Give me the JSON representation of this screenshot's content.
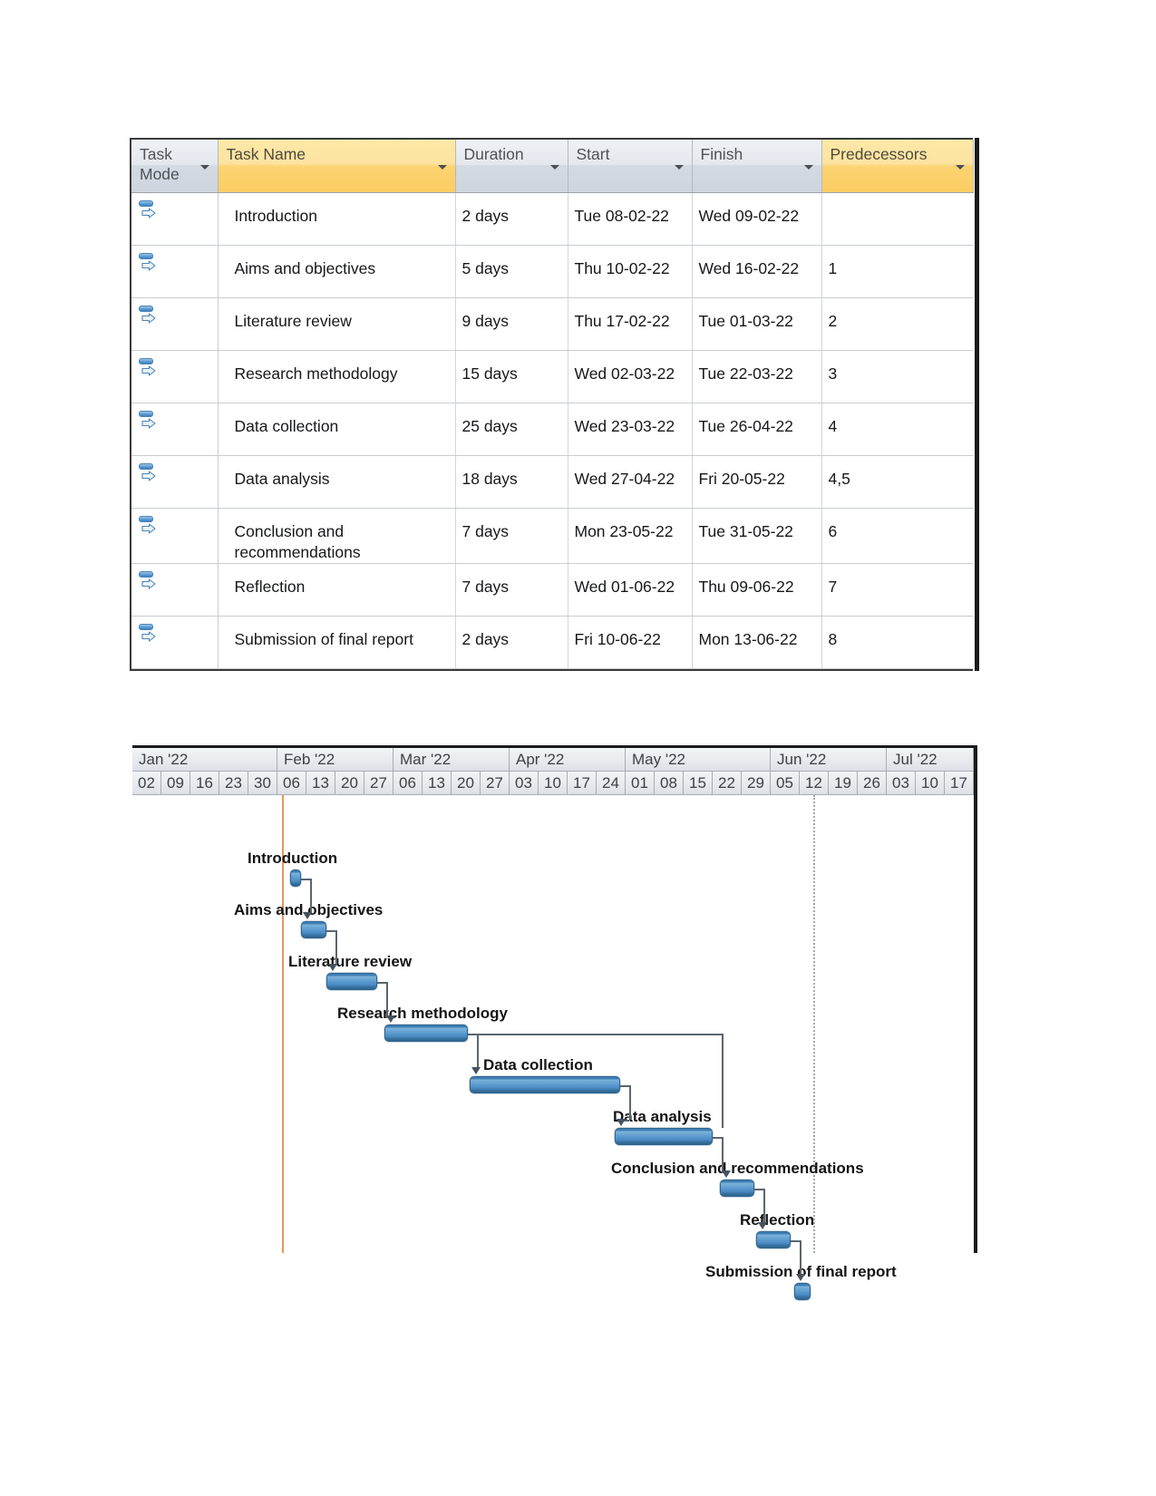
{
  "table": {
    "columns": [
      {
        "key": "mode",
        "label": "Task\nMode",
        "accent": false,
        "has_filter": true
      },
      {
        "key": "name",
        "label": "Task Name",
        "accent": true,
        "has_filter": true
      },
      {
        "key": "dur",
        "label": "Duration",
        "accent": false,
        "has_filter": true
      },
      {
        "key": "start",
        "label": "Start",
        "accent": false,
        "has_filter": true
      },
      {
        "key": "finish",
        "label": "Finish",
        "accent": false,
        "has_filter": true
      },
      {
        "key": "pred",
        "label": "Predecessors",
        "accent": true,
        "has_filter": true
      }
    ],
    "rows": [
      {
        "id": 1,
        "mode_icon": "auto-scheduled-icon",
        "name": "Introduction",
        "duration": "2 days",
        "start": "Tue 08-02-22",
        "finish": "Wed 09-02-22",
        "predecessors": ""
      },
      {
        "id": 2,
        "mode_icon": "auto-scheduled-icon",
        "name": "Aims and objectives",
        "duration": "5 days",
        "start": "Thu 10-02-22",
        "finish": "Wed 16-02-22",
        "predecessors": "1"
      },
      {
        "id": 3,
        "mode_icon": "auto-scheduled-icon",
        "name": "Literature review",
        "duration": "9 days",
        "start": "Thu 17-02-22",
        "finish": "Tue 01-03-22",
        "predecessors": "2"
      },
      {
        "id": 4,
        "mode_icon": "auto-scheduled-icon",
        "name": "Research methodology",
        "duration": "15 days",
        "start": "Wed 02-03-22",
        "finish": "Tue 22-03-22",
        "predecessors": "3"
      },
      {
        "id": 5,
        "mode_icon": "auto-scheduled-icon",
        "name": "Data collection",
        "duration": "25 days",
        "start": "Wed 23-03-22",
        "finish": "Tue 26-04-22",
        "predecessors": "4"
      },
      {
        "id": 6,
        "mode_icon": "auto-scheduled-icon",
        "name": "Data analysis",
        "duration": "18 days",
        "start": "Wed 27-04-22",
        "finish": "Fri 20-05-22",
        "predecessors": "4,5"
      },
      {
        "id": 7,
        "mode_icon": "auto-scheduled-icon",
        "name": "Conclusion and recommendations",
        "duration": "7 days",
        "start": "Mon 23-05-22",
        "finish": "Tue 31-05-22",
        "predecessors": "6"
      },
      {
        "id": 8,
        "mode_icon": "auto-scheduled-icon",
        "name": "Reflection",
        "duration": "7 days",
        "start": "Wed 01-06-22",
        "finish": "Thu 09-06-22",
        "predecessors": "7"
      },
      {
        "id": 9,
        "mode_icon": "auto-scheduled-icon",
        "name": "Submission of final report",
        "duration": "2 days",
        "start": "Fri 10-06-22",
        "finish": "Mon 13-06-22",
        "predecessors": "8"
      }
    ]
  },
  "gantt": {
    "months": [
      {
        "label": "Jan '22",
        "weeks": 5
      },
      {
        "label": "Feb '22",
        "weeks": 4
      },
      {
        "label": "Mar '22",
        "weeks": 4
      },
      {
        "label": "Apr '22",
        "weeks": 4
      },
      {
        "label": "May '22",
        "weeks": 5
      },
      {
        "label": "Jun '22",
        "weeks": 4
      },
      {
        "label": "Jul '22",
        "weeks": 3
      }
    ],
    "weeks": [
      "02",
      "09",
      "16",
      "23",
      "30",
      "06",
      "13",
      "20",
      "27",
      "06",
      "13",
      "20",
      "27",
      "03",
      "10",
      "17",
      "24",
      "01",
      "08",
      "15",
      "22",
      "29",
      "05",
      "12",
      "19",
      "26",
      "03",
      "10",
      "17"
    ],
    "today_marker_week": "06",
    "status_marker_week": "12",
    "bar_color": "#5c9bcf",
    "bar_border_color": "#2e6590",
    "today_line_color": "#e8833a",
    "status_line_color": "#a9a9a9",
    "bars": [
      {
        "task": "Introduction",
        "label": "Introduction",
        "duration_days": 2,
        "start": "Tue 08-02-22",
        "finish": "Wed 09-02-22"
      },
      {
        "task": "Aims and objectives",
        "label": "Aims and objectives",
        "duration_days": 5,
        "start": "Thu 10-02-22",
        "finish": "Wed 16-02-22"
      },
      {
        "task": "Literature review",
        "label": "Literature review",
        "duration_days": 9,
        "start": "Thu 17-02-22",
        "finish": "Tue 01-03-22"
      },
      {
        "task": "Research methodology",
        "label": "Research methodology",
        "duration_days": 15,
        "start": "Wed 02-03-22",
        "finish": "Tue 22-03-22"
      },
      {
        "task": "Data collection",
        "label": "Data collection",
        "duration_days": 25,
        "start": "Wed 23-03-22",
        "finish": "Tue 26-04-22"
      },
      {
        "task": "Data analysis",
        "label": "Data analysis",
        "duration_days": 18,
        "start": "Wed 27-04-22",
        "finish": "Fri 20-05-22"
      },
      {
        "task": "Conclusion and recommendations",
        "label": "Conclusion and recommendations",
        "duration_days": 7,
        "start": "Mon 23-05-22",
        "finish": "Tue 31-05-22"
      },
      {
        "task": "Reflection",
        "label": "Reflection",
        "duration_days": 7,
        "start": "Wed 01-06-22",
        "finish": "Thu 09-06-22"
      },
      {
        "task": "Submission of final report",
        "label": "Submission of final report",
        "duration_days": 2,
        "start": "Fri 10-06-22",
        "finish": "Mon 13-06-22"
      }
    ]
  }
}
